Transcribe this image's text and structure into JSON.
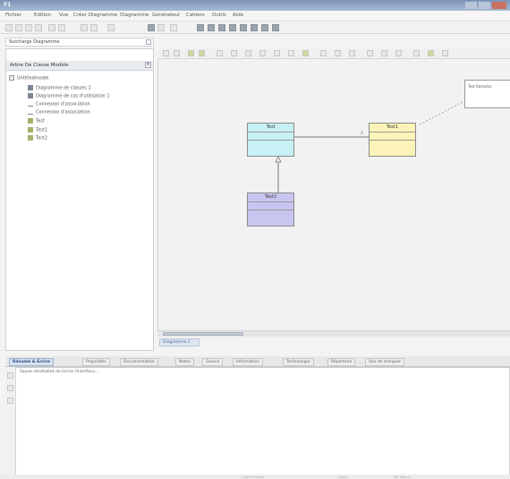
{
  "window": {
    "title": "F1"
  },
  "menu": [
    "Fichier",
    "Edition",
    "Vue",
    "Créer Diagramme",
    "Diagramme",
    "Générateur",
    "Cahiers",
    "Outils",
    "Aide"
  ],
  "left_panel": {
    "search_label": "Surcharge Diagramme",
    "header": "Arbre De Classe Modèle",
    "tree": [
      {
        "label": "Untitledmodel",
        "level": 0,
        "icon": "folder-icon"
      },
      {
        "label": "Diagramme de classes 1",
        "level": 1,
        "icon": "class-diagram-icon"
      },
      {
        "label": "Diagramme de cas d'utilisation 1",
        "level": 1,
        "icon": "usecase-diagram-icon"
      },
      {
        "label": "Connexion d'association",
        "level": 1,
        "icon": "association-icon"
      },
      {
        "label": "Connexion d'association",
        "level": 1,
        "icon": "association-icon"
      },
      {
        "label": "Test",
        "level": 1,
        "icon": "class-icon"
      },
      {
        "label": "Test1",
        "level": 1,
        "icon": "class-icon"
      },
      {
        "label": "Test2",
        "level": 1,
        "icon": "class-icon"
      }
    ]
  },
  "diagram": {
    "tab_label": "Diagramme 1",
    "note_text": "Test Remarks",
    "classes": [
      {
        "name": "Test",
        "color": "#c7f1f4"
      },
      {
        "name": "Test1",
        "color": "#fbf3b8"
      },
      {
        "name": "Test2",
        "color": "#c9c5f1"
      }
    ],
    "association_end_label": "1"
  },
  "bottom": {
    "tabs": [
      "Résumé & Ecrire",
      "Propriétés",
      "Documentation",
      "Notes",
      "Source",
      "Information",
      "Technologie",
      "Répertoire",
      "Vue de marquer"
    ],
    "log_text": "Sauve réinitialisé de Ecrire l'interface...",
    "status_faint": [
      "Untitled Model",
      "Classe",
      "Par défaut"
    ]
  }
}
